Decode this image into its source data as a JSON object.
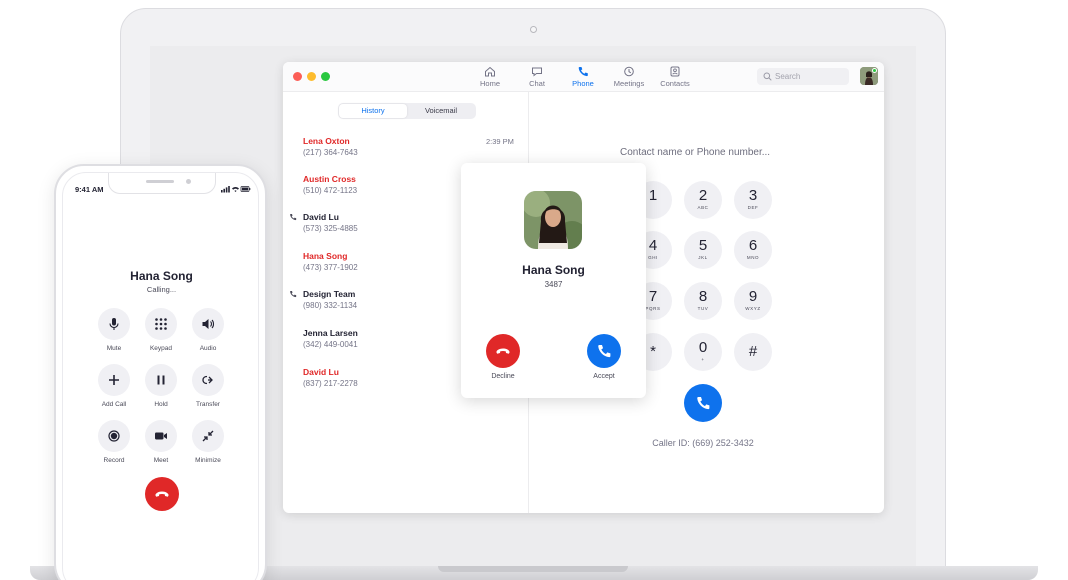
{
  "app": {
    "nav": [
      {
        "label": "Home",
        "icon": "home-icon"
      },
      {
        "label": "Chat",
        "icon": "chat-icon"
      },
      {
        "label": "Phone",
        "icon": "phone-icon",
        "active": true
      },
      {
        "label": "Meetings",
        "icon": "clock-icon"
      },
      {
        "label": "Contacts",
        "icon": "contacts-icon"
      }
    ],
    "search": {
      "placeholder": "Search"
    },
    "history_tabs": [
      {
        "label": "History",
        "active": true
      },
      {
        "label": "Voicemail",
        "active": false
      }
    ],
    "calls": [
      {
        "name": "Lena Oxton",
        "number": "(217) 364-7643",
        "time": "2:39 PM",
        "missed": true,
        "outgoing": false
      },
      {
        "name": "Austin Cross",
        "number": "(510) 472-1123",
        "time": "",
        "missed": true,
        "outgoing": false
      },
      {
        "name": "David Lu",
        "number": "(573) 325-4885",
        "time": "",
        "missed": false,
        "outgoing": true
      },
      {
        "name": "Hana Song",
        "number": "(473) 377-1902",
        "time": "",
        "missed": true,
        "outgoing": false
      },
      {
        "name": "Design Team",
        "number": "(980) 332-1134",
        "time": "",
        "missed": false,
        "outgoing": true
      },
      {
        "name": "Jenna Larsen",
        "number": "(342) 449-0041",
        "time": "",
        "missed": false,
        "outgoing": false
      },
      {
        "name": "David Lu",
        "number": "(837) 217-2278",
        "time": "",
        "missed": true,
        "outgoing": false
      }
    ],
    "dialer": {
      "placeholder": "Contact name or Phone number...",
      "keys": [
        {
          "digit": "1",
          "letters": ""
        },
        {
          "digit": "2",
          "letters": "ABC"
        },
        {
          "digit": "3",
          "letters": "DEF"
        },
        {
          "digit": "4",
          "letters": "GHI"
        },
        {
          "digit": "5",
          "letters": "JKL"
        },
        {
          "digit": "6",
          "letters": "MNO"
        },
        {
          "digit": "7",
          "letters": "PQRS"
        },
        {
          "digit": "8",
          "letters": "TUV"
        },
        {
          "digit": "9",
          "letters": "WXYZ"
        },
        {
          "digit": "*",
          "letters": ""
        },
        {
          "digit": "0",
          "letters": "+"
        },
        {
          "digit": "#",
          "letters": ""
        }
      ],
      "caller_id": "Caller ID: (669) 252-3432"
    },
    "incoming": {
      "name": "Hana Song",
      "extension": "3487",
      "decline_label": "Decline",
      "accept_label": "Accept"
    }
  },
  "phone": {
    "time": "9:41 AM",
    "caller_name": "Hana Song",
    "status": "Calling...",
    "buttons": [
      {
        "label": "Mute",
        "icon": "mic-icon"
      },
      {
        "label": "Keypad",
        "icon": "keypad-icon"
      },
      {
        "label": "Audio",
        "icon": "speaker-icon"
      },
      {
        "label": "Add Call",
        "icon": "plus-icon"
      },
      {
        "label": "Hold",
        "icon": "pause-icon"
      },
      {
        "label": "Transfer",
        "icon": "transfer-icon"
      },
      {
        "label": "Record",
        "icon": "record-icon"
      },
      {
        "label": "Meet",
        "icon": "video-icon"
      },
      {
        "label": "Minimize",
        "icon": "minimize-icon"
      }
    ]
  },
  "colors": {
    "accent_blue": "#0e72ed",
    "missed_red": "#e02828",
    "end_call_red": "#e02828"
  }
}
